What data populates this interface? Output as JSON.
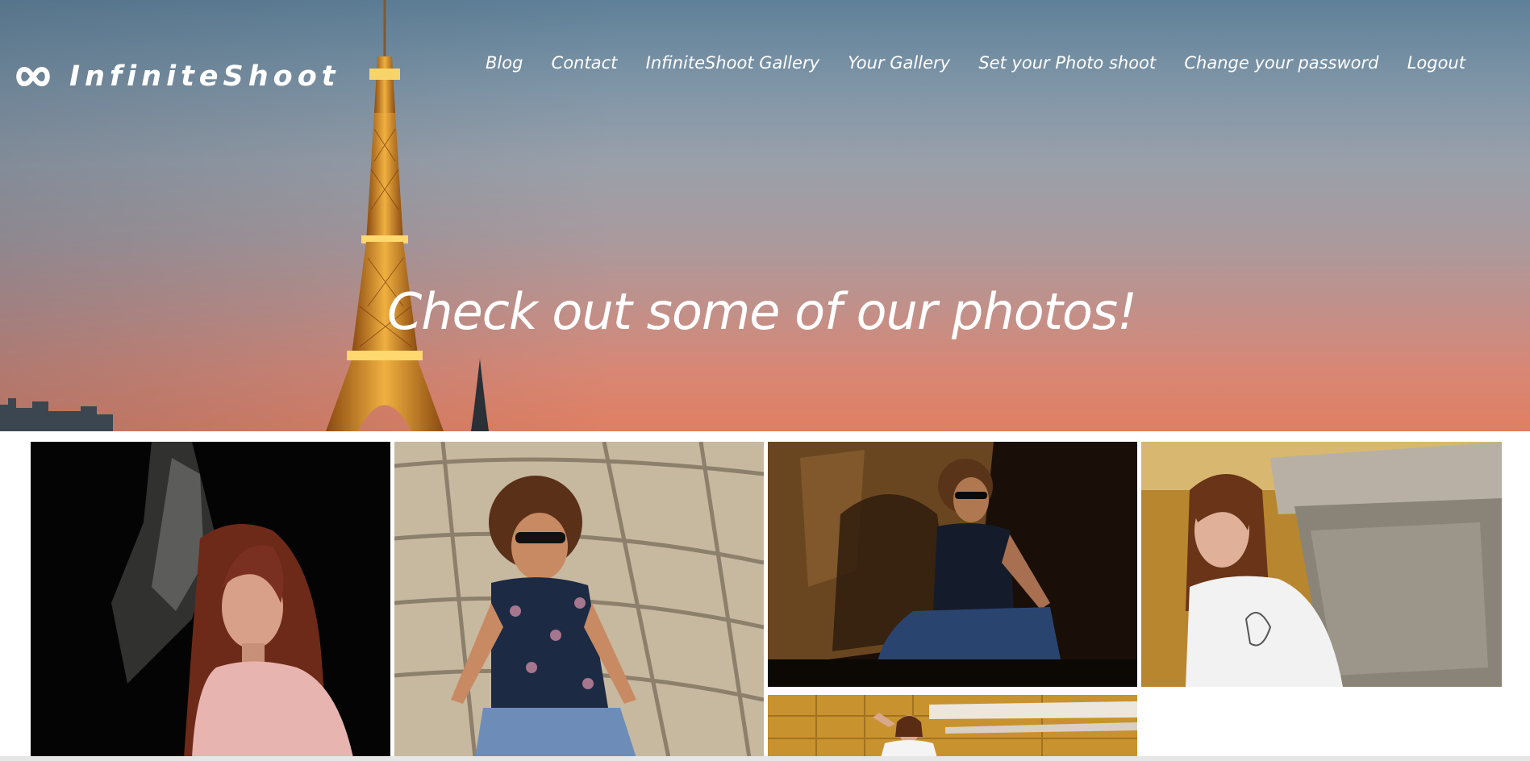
{
  "brand": {
    "name": "InfiniteShoot",
    "icon": "infinity-icon"
  },
  "nav": {
    "items": [
      {
        "label": "Blog"
      },
      {
        "label": "Contact"
      },
      {
        "label": "InfiniteShoot Gallery"
      },
      {
        "label": "Your Gallery"
      },
      {
        "label": "Set your Photo shoot"
      },
      {
        "label": "Change your password"
      },
      {
        "label": "Logout"
      }
    ]
  },
  "hero": {
    "heading": "Check out some of our photos!",
    "background": "eiffel-tower-sunset-photo"
  },
  "gallery": {
    "photos": [
      {
        "subject": "woman-pink-blouse-dark-portrait"
      },
      {
        "subject": "curly-man-sunglasses-sitting-pavement"
      },
      {
        "subject": "curly-man-sunglasses-shadow-portrait"
      },
      {
        "subject": "woman-white-tshirt-stone-wall"
      },
      {
        "subject": "woman-yellow-building-facade"
      }
    ]
  },
  "colors": {
    "sky_top": "#5e8098",
    "sky_bottom": "#e07f62",
    "text": "#ffffff",
    "tower_gold": "#e8a030"
  }
}
